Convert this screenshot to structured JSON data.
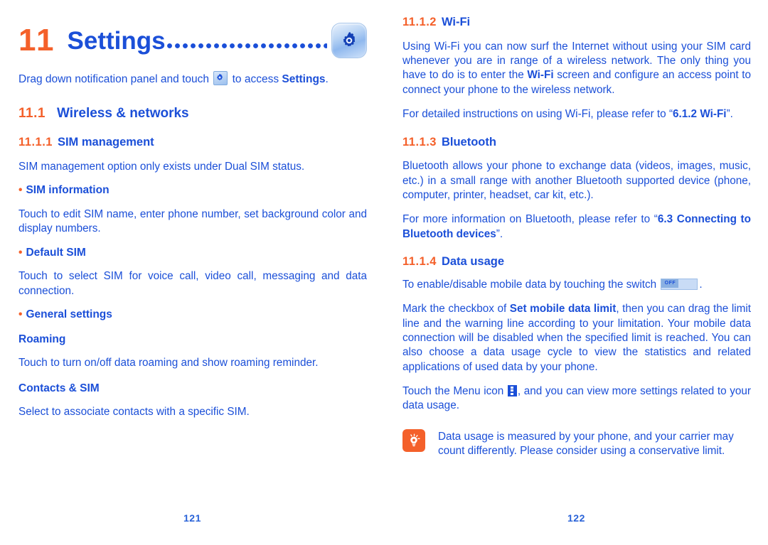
{
  "chapter": {
    "number": "11",
    "title": "Settings",
    "leader": "dotted-leader",
    "icon": "settings-gear-icon"
  },
  "left_column": {
    "intro": {
      "before_icon": "Drag down notification panel and touch ",
      "icon": "settings-gear-icon",
      "after_icon": " to access ",
      "bold_tail": "Settings",
      "end": "."
    },
    "section_11_1": {
      "number": "11.1",
      "title": "Wireless & networks"
    },
    "section_11_1_1": {
      "number": "11.1.1",
      "title": "SIM management",
      "intro": "SIM management option only exists under Dual SIM status.",
      "items": [
        {
          "bullet": "•",
          "heading": "SIM information",
          "body": "Touch to edit SIM name, enter phone number, set background color and display numbers."
        },
        {
          "bullet": "•",
          "heading": "Default SIM",
          "body": "Touch to select SIM for voice call, video call, messaging and data connection."
        },
        {
          "bullet": "•",
          "heading": "General settings",
          "body": ""
        }
      ],
      "subsections": [
        {
          "heading": "Roaming",
          "body": "Touch to turn on/off data roaming and show roaming reminder."
        },
        {
          "heading": "Contacts & SIM",
          "body": "Select to associate contacts with a specific SIM."
        }
      ]
    },
    "page_number": "121"
  },
  "right_column": {
    "section_11_1_2": {
      "number": "11.1.2",
      "title": "Wi-Fi",
      "para1_a": "Using Wi-Fi you can now surf the Internet without using your SIM card whenever you are in range of a wireless network. The only thing you have to do is to enter the ",
      "para1_bold": "Wi-Fi",
      "para1_b": " screen and configure an access point to connect your phone to the wireless network.",
      "para2_a": "For detailed instructions on using Wi-Fi, please refer to “",
      "para2_bold": "6.1.2 Wi-Fi",
      "para2_b": "”."
    },
    "section_11_1_3": {
      "number": "11.1.3",
      "title": "Bluetooth",
      "para1": "Bluetooth allows your phone to exchange data (videos, images, music, etc.) in a small range with another Bluetooth supported device (phone, computer, printer, headset, car kit, etc.).",
      "para2_a": "For more information on Bluetooth, please refer to “",
      "para2_bold": "6.3 Connecting to Bluetooth devices",
      "para2_b": "”."
    },
    "section_11_1_4": {
      "number": "11.1.4",
      "title": "Data usage",
      "para1_a": "To enable/disable mobile data by touching the switch ",
      "switch_label": "OFF",
      "para1_b": ".",
      "para2_a": "Mark the checkbox of ",
      "para2_bold": "Set mobile data limit",
      "para2_b": ", then you can drag the limit line and the warning line according to your limitation. Your mobile data connection will be disabled when the specified limit is reached. You can also choose a data usage cycle to view the statistics and related applications of used data by your phone.",
      "para3_a": "Touch the Menu icon ",
      "para3_icon": "overflow-menu-icon",
      "para3_b": ", and you can view more settings related to your data usage.",
      "tip": {
        "icon": "lightbulb-tip-icon",
        "text": "Data usage is measured by your phone, and your carrier may count differently. Please consider using a conservative limit."
      }
    },
    "page_number": "122"
  },
  "colors": {
    "accent_orange": "#F4602A",
    "text_blue": "#1B4FD8",
    "folio_blue": "#2A63D8"
  }
}
